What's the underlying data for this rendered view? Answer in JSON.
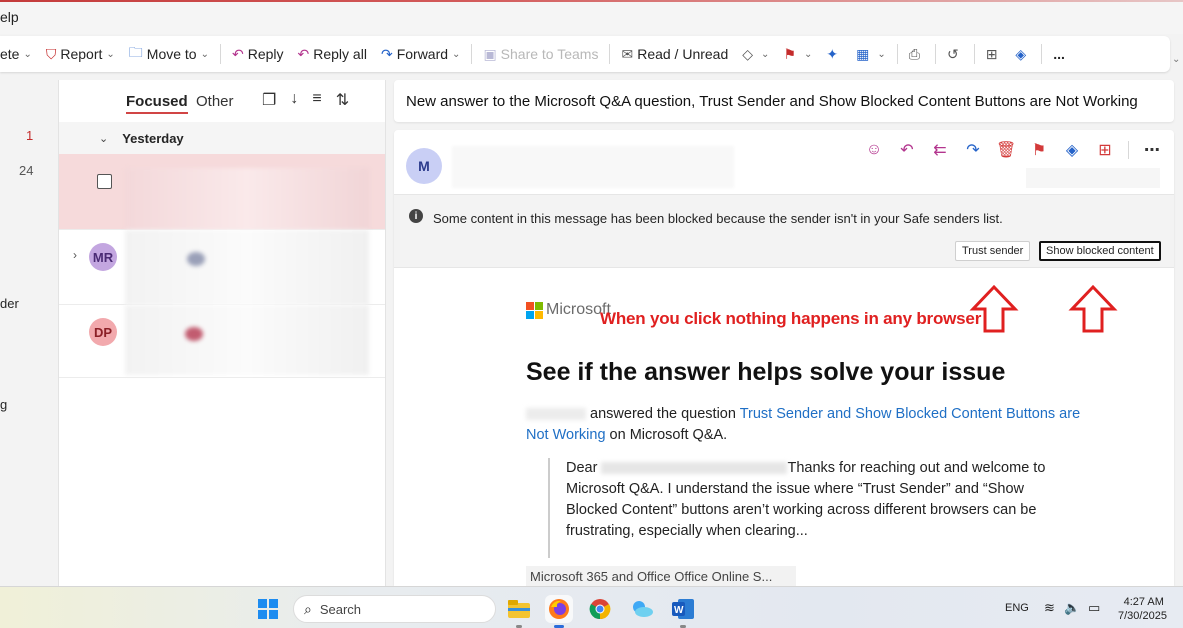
{
  "menu": {
    "help_fragment": "elp"
  },
  "ribbon": {
    "delete_fragment": "ete",
    "report": "Report",
    "move_to": "Move to",
    "reply": "Reply",
    "reply_all": "Reply all",
    "forward": "Forward",
    "share_to_teams": "Share to Teams",
    "read_unread": "Read / Unread",
    "more": "..."
  },
  "leftnav": {
    "count_1": "1",
    "count_2": "24",
    "frag_der": "der",
    "frag_g": "g"
  },
  "message_list": {
    "tab_focused": "Focused",
    "tab_other": "Other",
    "group_label": "Yesterday",
    "items": [
      {
        "avatar": ""
      },
      {
        "avatar": "MR",
        "avatar_color": "#c3a6e0"
      },
      {
        "avatar": "DP",
        "avatar_color": "#f2a9ad"
      }
    ]
  },
  "reading_pane": {
    "subject": "New answer to the Microsoft Q&A question, Trust Sender and Show Blocked Content Buttons are Not Working",
    "sender_initial": "M",
    "info_text": "Some content in this message has been blocked because the sender isn't in your Safe senders list.",
    "trust_sender": "Trust sender",
    "show_blocked": "Show blocked content",
    "brand": "Microsoft",
    "annotation": "When you click nothing happens in any browser",
    "headline": "See if the answer helps solve your issue",
    "p1_pre": "answered the question ",
    "p1_link": "Trust Sender and Show Blocked Content Buttons are Not Working",
    "p1_post": " on Microsoft Q&A.",
    "quote_dear": "Dear",
    "quote_text": "Thanks for reaching out and welcome to Microsoft Q&A. I understand the issue where “Trust Sender” and “Show Blocked Content” buttons aren’t working across different browsers can be frustrating, especially when clearing...",
    "cutoff_text": "Microsoft 365 and Office Office Online S..."
  },
  "taskbar": {
    "search_placeholder": "Search",
    "lang": "ENG",
    "time": "4:27 AM",
    "date": "7/30/2025"
  },
  "colors": {
    "accent_red": "#d14545",
    "selected_row": "#f6dadb",
    "link": "#1f6fc5",
    "annotation_red": "#e02020"
  }
}
